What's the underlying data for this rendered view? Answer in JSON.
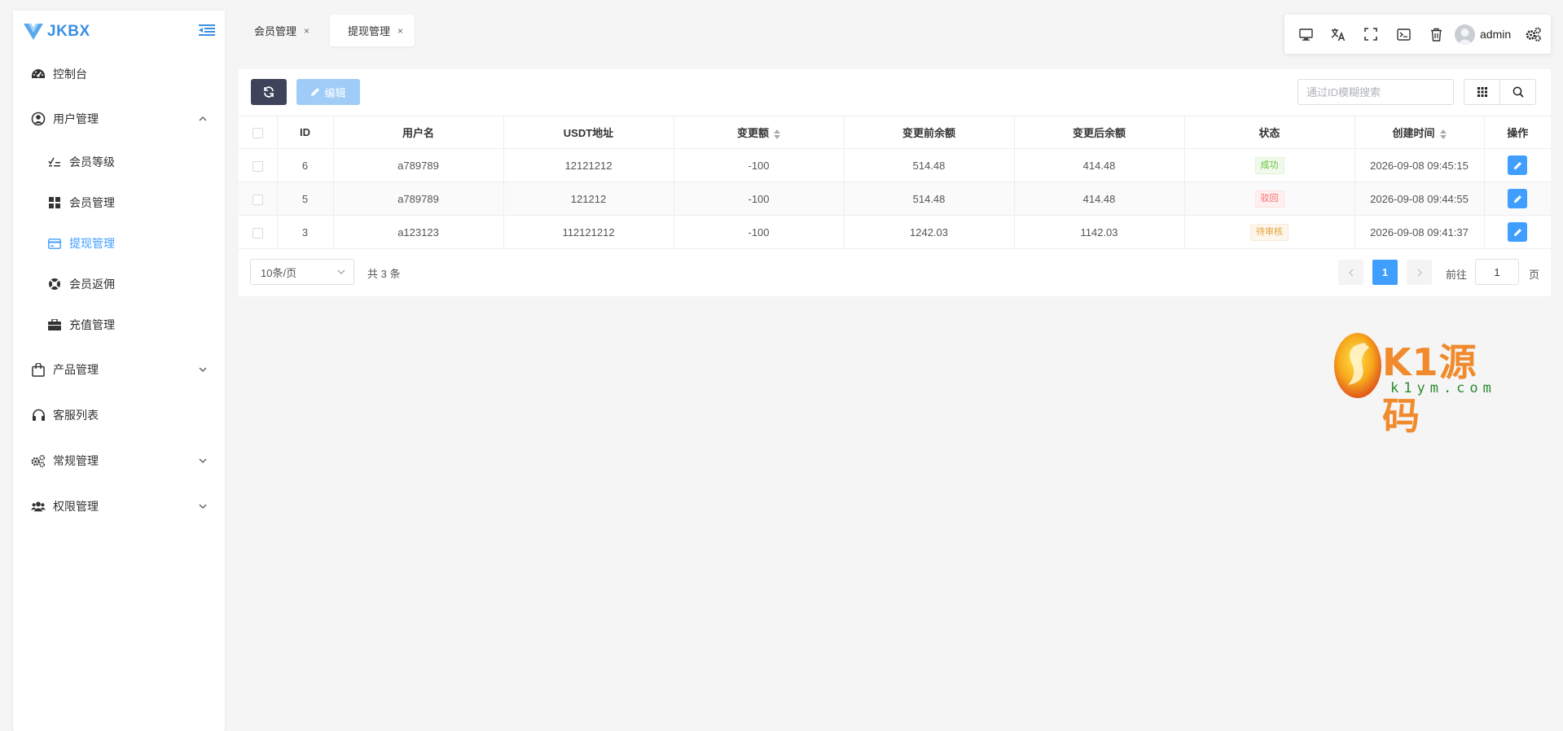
{
  "app": {
    "logo_text": "JKBX"
  },
  "sidebar": {
    "items": [
      {
        "label": "控制台"
      },
      {
        "label": "用户管理"
      },
      {
        "label": "会员等级"
      },
      {
        "label": "会员管理"
      },
      {
        "label": "提现管理"
      },
      {
        "label": "会员返佣"
      },
      {
        "label": "充值管理"
      },
      {
        "label": "产品管理"
      },
      {
        "label": "客服列表"
      },
      {
        "label": "常规管理"
      },
      {
        "label": "权限管理"
      }
    ]
  },
  "tabs": [
    {
      "label": "会员管理",
      "close": "×"
    },
    {
      "label": "提现管理",
      "close": "×"
    }
  ],
  "toolbar": {
    "user_name": "admin"
  },
  "actions": {
    "edit_label": "编辑"
  },
  "search": {
    "placeholder": "通过ID模糊搜索"
  },
  "table": {
    "headers": [
      "ID",
      "用户名",
      "USDT地址",
      "变更额",
      "变更前余额",
      "变更后余额",
      "状态",
      "创建时间",
      "操作"
    ],
    "rows": [
      {
        "id": "6",
        "username": "a789789",
        "usdt": "12121212",
        "change": "-100",
        "before": "514.48",
        "after": "414.48",
        "status": "成功",
        "created": "2026-09-08 09:45:15"
      },
      {
        "id": "5",
        "username": "a789789",
        "usdt": "121212",
        "change": "-100",
        "before": "514.48",
        "after": "414.48",
        "status": "驳回",
        "created": "2026-09-08 09:44:55"
      },
      {
        "id": "3",
        "username": "a123123",
        "usdt": "112121212",
        "change": "-100",
        "before": "1242.03",
        "after": "1142.03",
        "status": "待审核",
        "created": "2026-09-08 09:41:37"
      }
    ]
  },
  "pagination": {
    "page_size": "10条/页",
    "total": "共 3 条",
    "current_page": "1",
    "goto_label": "前往",
    "goto_value": "1",
    "goto_suffix": "页"
  },
  "watermark": {
    "title": "K1源码",
    "url": "k1ym.com"
  },
  "colors": {
    "accent": "#409eff",
    "logo": "#3b8fe0",
    "sidebar_bg": "#ffffff",
    "refresh_btn": "#3d4459"
  }
}
